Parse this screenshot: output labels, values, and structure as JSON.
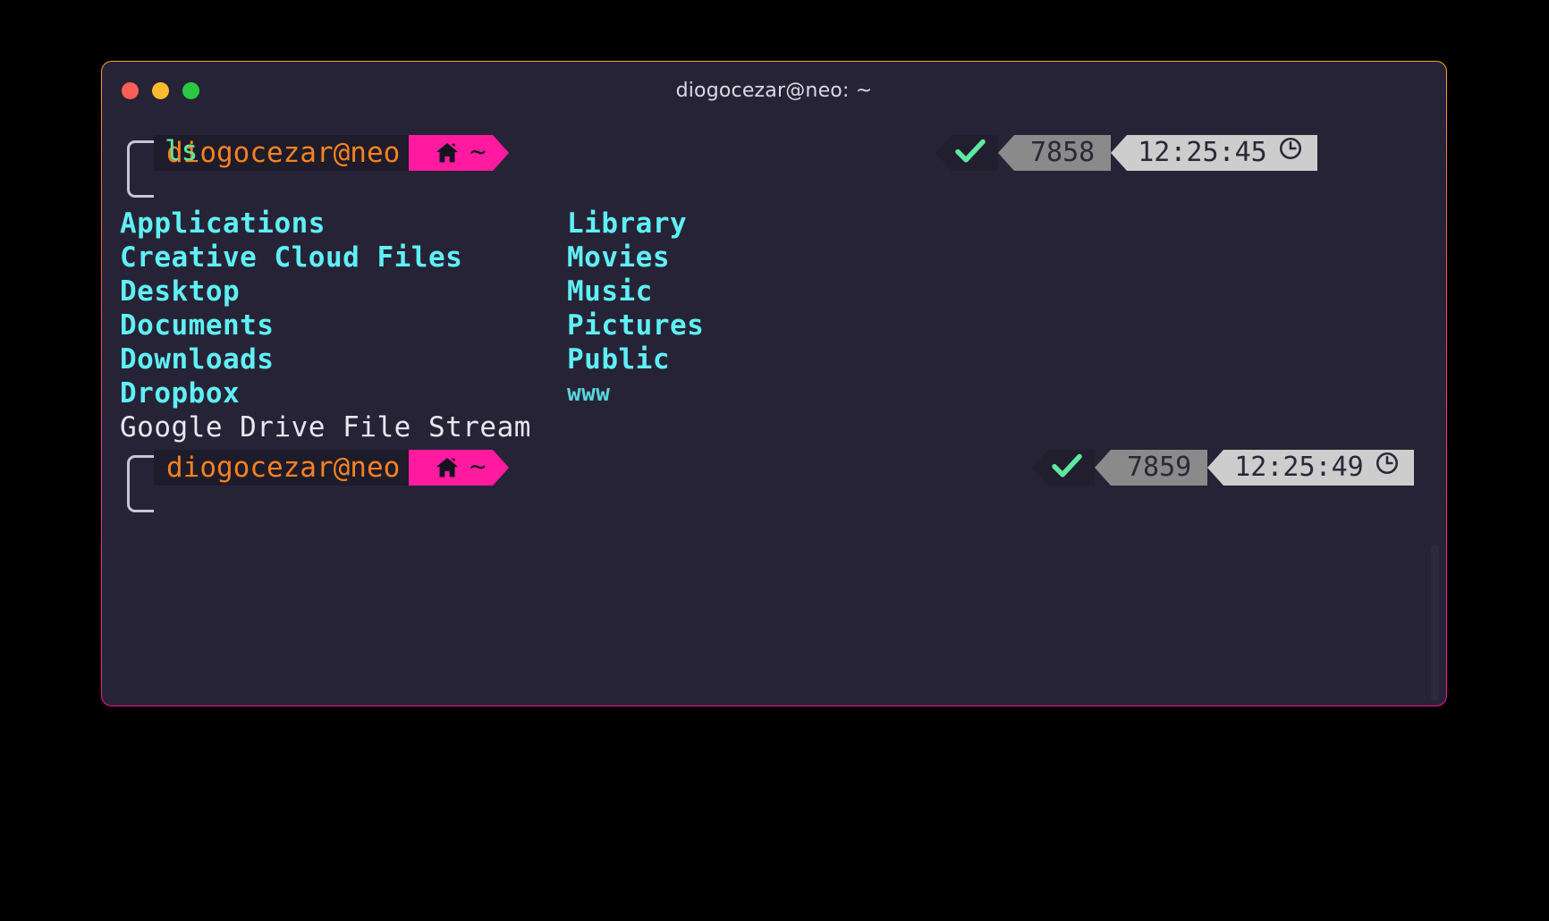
{
  "window": {
    "title": "diogocezar@neo: ~",
    "traffic_lights": [
      {
        "name": "close",
        "color": "#fb5f57"
      },
      {
        "name": "minimize",
        "color": "#fcbb2d"
      },
      {
        "name": "maximize",
        "color": "#2ac840"
      }
    ],
    "border_gradient_from": "#f5a623",
    "border_gradient_to": "#ff1493",
    "background": "#272336"
  },
  "theme": {
    "dir_color": "#5ff0f5",
    "file_color": "#e8e6ef",
    "user_color": "#f58220",
    "home_segment_color": "#ff1aa0",
    "command_color": "#5ee8a0",
    "ok_check_color": "#5ee8a0",
    "pid_segment_color": "#8a8a8a",
    "time_segment_color": "#cdcdcd"
  },
  "prompt_1": {
    "user_host": "diogocezar@neo",
    "path": "~",
    "home_icon": "home-icon",
    "status": {
      "exit_icon": "check-icon",
      "pid": "7858",
      "time": "12:25:45",
      "clock_icon": "clock-icon"
    },
    "command": "ls"
  },
  "ls_output": {
    "rows": [
      {
        "left": "Applications",
        "left_type": "dir",
        "right": "Library",
        "right_type": "dir"
      },
      {
        "left": "Creative Cloud Files",
        "left_type": "dir",
        "right": "Movies",
        "right_type": "dir"
      },
      {
        "left": "Desktop",
        "left_type": "dir",
        "right": "Music",
        "right_type": "dir"
      },
      {
        "left": "Documents",
        "left_type": "dir",
        "right": "Pictures",
        "right_type": "dir"
      },
      {
        "left": "Downloads",
        "left_type": "dir",
        "right": "Public",
        "right_type": "dir"
      },
      {
        "left": "Dropbox",
        "left_type": "dir",
        "right": "www",
        "right_type": "dim"
      },
      {
        "left": "Google Drive File Stream",
        "left_type": "file",
        "right": "",
        "right_type": "none"
      }
    ]
  },
  "prompt_2": {
    "user_host": "diogocezar@neo",
    "path": "~",
    "home_icon": "home-icon",
    "status": {
      "exit_icon": "check-icon",
      "pid": "7859",
      "time": "12:25:49",
      "clock_icon": "clock-icon"
    },
    "command": ""
  }
}
